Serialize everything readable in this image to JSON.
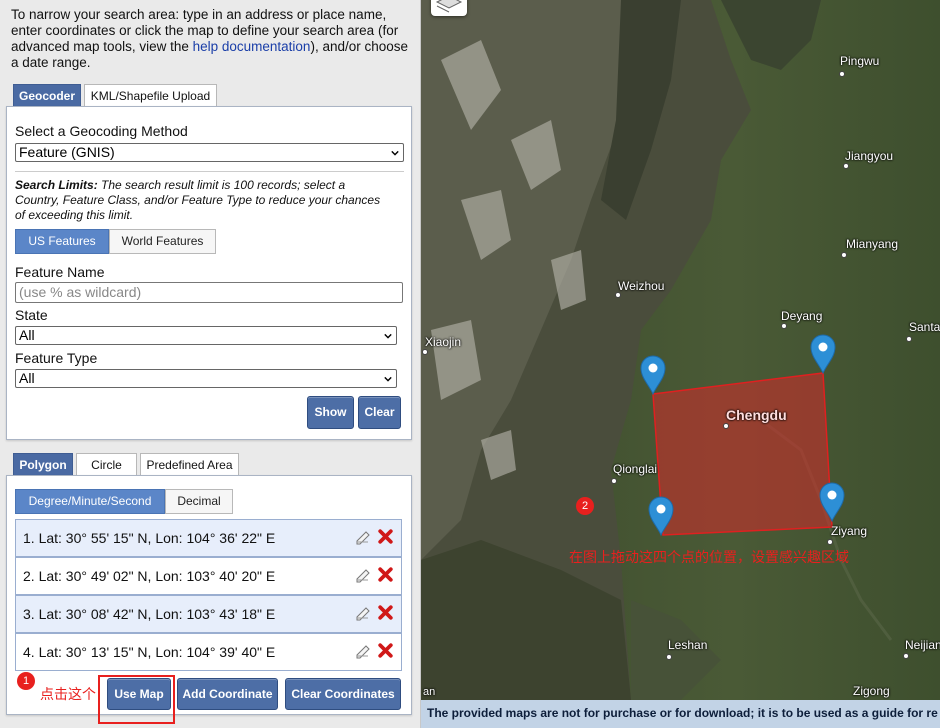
{
  "intro": {
    "text_before": "To narrow your search area: type in an address or place name, enter coordinates or click the map to define your search area (for advanced map tools, view the ",
    "link": "help documentation",
    "text_after": "), and/or choose a date range."
  },
  "search_tabs": [
    "Geocoder",
    "KML/Shapefile Upload"
  ],
  "geocoder": {
    "method_label": "Select a Geocoding Method",
    "method_value": "Feature (GNIS)",
    "limits_bold": "Search Limits:",
    "limits_text": " The search result limit is 100 records; select a Country, Feature Class, and/or Feature Type to reduce your chances of exceeding this limit.",
    "scope_options": [
      "US Features",
      "World Features"
    ],
    "feature_name_label": "Feature Name",
    "feature_name_placeholder": "(use % as wildcard)",
    "state_label": "State",
    "state_value": "All",
    "feature_type_label": "Feature Type",
    "feature_type_value": "All",
    "show_label": "Show",
    "clear_label": "Clear"
  },
  "area_tabs": [
    "Polygon",
    "Circle",
    "Predefined Area"
  ],
  "format_options": [
    "Degree/Minute/Second",
    "Decimal"
  ],
  "coordinates": [
    "1.  Lat: 30° 55' 15\" N, Lon: 104° 36' 22\" E",
    "2.  Lat: 30° 49' 02\" N, Lon: 103° 40' 20\" E",
    "3.  Lat: 30° 08' 42\" N, Lon: 103° 43' 18\" E",
    "4.  Lat: 30° 13' 15\" N, Lon: 104° 39' 40\" E"
  ],
  "actions": {
    "use_map": "Use Map",
    "add_coordinate": "Add Coordinate",
    "clear_coordinates": "Clear Coordinates"
  },
  "annotations": {
    "badge_1": "1",
    "note_1": "点击这个",
    "badge_2": "2",
    "note_2": "在图上拖动这四个点的位置，设置感兴趣区域",
    "color": "#e8201e"
  },
  "map": {
    "cities": [
      "Pingwu",
      "Jiangyou",
      "Mianyang",
      "Weizhou",
      "Deyang",
      "Santai",
      "Xiaojin",
      "Chengdu",
      "Qionglai",
      "Ziyang",
      "Leshan",
      "Neijiang",
      "Zigong",
      "an"
    ],
    "footer": "The provided maps are not for purchase or for download; it is to be used as a guide for re"
  },
  "colors": {
    "tab_active": "#4a6aa3",
    "segment_active": "#5b86c8",
    "polygon_fill": "#d42a2a",
    "footer_bg": "#c2d3e6"
  }
}
